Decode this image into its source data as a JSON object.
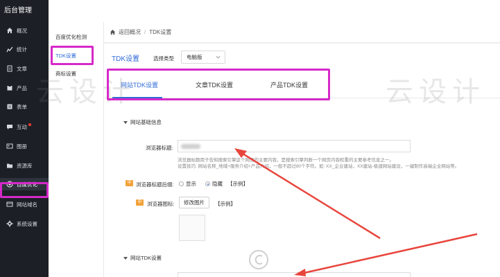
{
  "app": {
    "brand": "后台管理"
  },
  "sidebar": {
    "items": [
      {
        "label": "概况",
        "icon": "home-icon"
      },
      {
        "label": "统计",
        "icon": "chart-icon"
      },
      {
        "label": "文章",
        "icon": "doc-icon"
      },
      {
        "label": "产品",
        "icon": "box-icon"
      },
      {
        "label": "表单",
        "icon": "form-icon"
      },
      {
        "label": "互动",
        "icon": "chat-icon",
        "badge": true
      },
      {
        "label": "图册",
        "icon": "image-icon"
      },
      {
        "label": "资源库",
        "icon": "folder-icon"
      },
      {
        "label": "百度优化",
        "icon": "target-icon",
        "active": true
      },
      {
        "label": "网站域名",
        "icon": "globe-icon"
      },
      {
        "label": "系统设置",
        "icon": "gear-icon"
      }
    ]
  },
  "subnav": {
    "items": [
      {
        "label": "百度优化检测"
      },
      {
        "label": "TDK设置",
        "active": true
      },
      {
        "label": "商标设置"
      }
    ]
  },
  "breadcrumb": {
    "back": "返回概况",
    "separator": "/",
    "current": "TDK设置"
  },
  "panel": {
    "title": "TDK设置",
    "type_label": "选择类型",
    "type_value": "电脑版",
    "tabs": [
      "网站TDK设置",
      "文章TDK设置",
      "产品TDK设置"
    ],
    "section1": "网站基础信息",
    "browser_title_label": "浏览器标题:",
    "hint_line1": "浏览器标题用于告知搜索引擎这个网页的主要内容，是搜索引擎判断一个网页内容权重的主要参考信息之一。",
    "hint_line2": "设置技巧: 网站名称_地域+服务介绍+产品介绍，一般不超过80个字符。如: XX_企业建站，XX建站-极速网站建设，一键制作高端企业网站等。",
    "zh_badge": "中",
    "suffix_label": "浏览器标题后缀:",
    "radio_show": "显示",
    "radio_hide": "隐藏",
    "example": "【示例】",
    "icon_label": "浏览器图标:",
    "change_image": "修改图片",
    "section2": "网站TDK设置"
  },
  "watermark": {
    "text": "云设计"
  },
  "colors": {
    "accent": "#2f6bd8",
    "highlight": "#d629c9",
    "arrow": "#e8453c",
    "sidebar": "#1c1f26"
  }
}
